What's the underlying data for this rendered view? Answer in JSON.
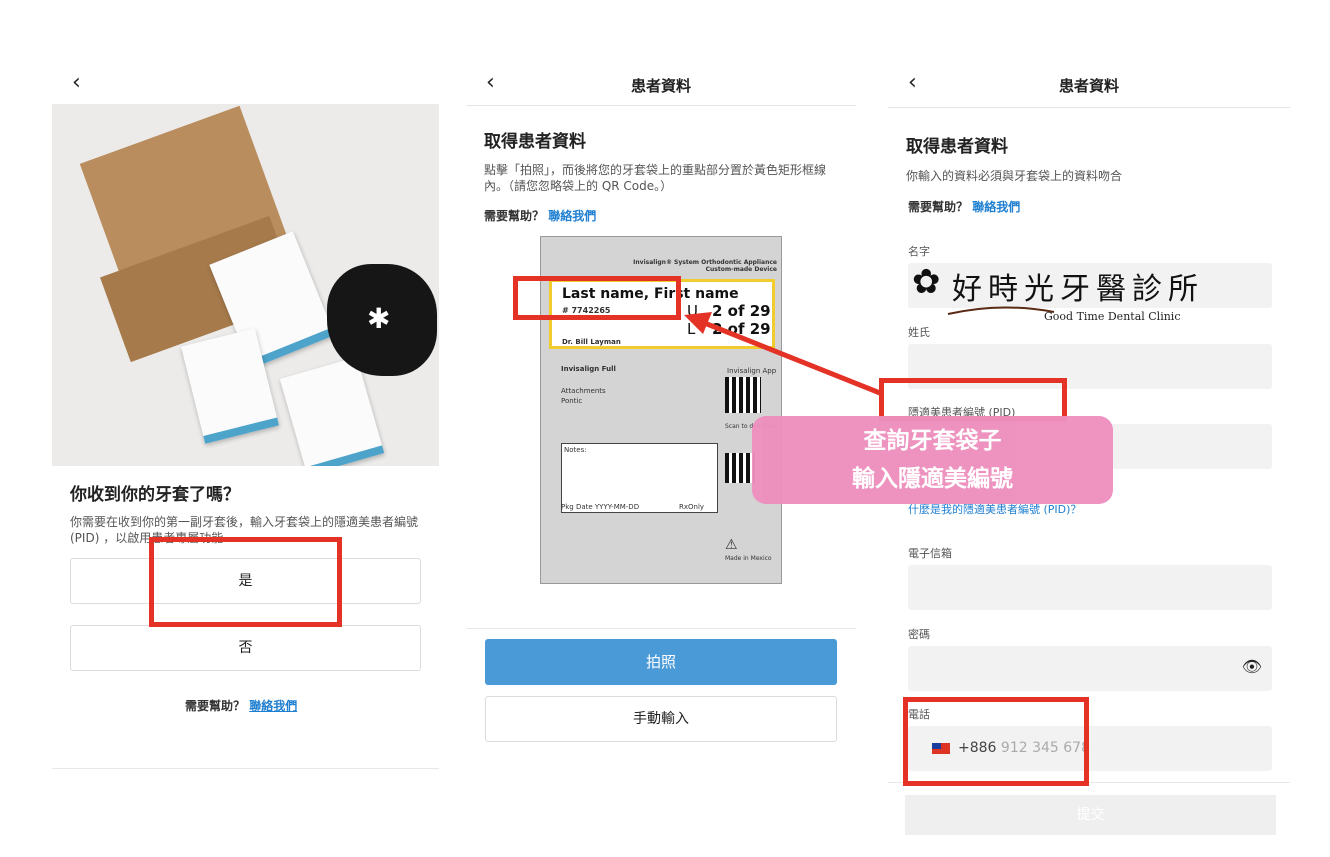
{
  "screen1": {
    "question": "你收到你的牙套了嗎？",
    "description": "你需要在收到你的第一副牙套後，輸入牙套袋上的隱適美患者編號 (PID) ，以啟用患者專屬功能",
    "yes_label": "是",
    "no_label": "否",
    "help_text": "需要幫助？",
    "help_link": "聯絡我們"
  },
  "screen2": {
    "header_title": "患者資料",
    "section_title": "取得患者資料",
    "description": "點擊「拍照」，而後將您的牙套袋上的重點部分置於黃色矩形框線內。（請您忽略袋上的 QR Code。）",
    "help_text": "需要幫助？",
    "help_link": "聯絡我們",
    "card": {
      "brand": "Invisalign® System Orthodontic Appliance",
      "brand_sub": "Custom-made Device",
      "name": "Last name, First name",
      "patient_id": "# 7742265",
      "upper": "U",
      "lower": "L",
      "count1": "2 of 29",
      "count2": "2 of 29",
      "doctor": "Dr. Bill Layman",
      "product": "Invisalign Full",
      "attachments": "Attachments",
      "pontic": "Pontic",
      "app": "Invisalign App",
      "scan": "Scan to download",
      "notes": "Notes:",
      "pkg_date": "Pkg Date YYYY-MM-DD",
      "rx": "RxOnly",
      "made_in": "Made in Mexico"
    },
    "photo_button": "拍照",
    "manual_button": "手動輸入"
  },
  "screen3": {
    "header_title": "患者資料",
    "section_title": "取得患者資料",
    "description": "你輸入的資料必須與牙套袋上的資料吻合",
    "help_text": "需要幫助？",
    "help_link": "聯絡我們",
    "first_name_label": "名字",
    "last_name_label": "姓氏",
    "pid_label": "隱適美患者編號 (PID)",
    "pid_help_link": "什麼是我的隱適美患者編號 (PID)？",
    "email_label": "電子信箱",
    "password_label": "密碼",
    "phone_label": "電話",
    "phone_code": "+886",
    "phone_placeholder": "912 345 678",
    "submit_label": "提交"
  },
  "logo": {
    "name": "好時光牙醫診所",
    "english": "Good Time Dental Clinic"
  },
  "callout": {
    "line1": "查詢牙套袋子",
    "line2": "輸入隱適美編號"
  },
  "colors": {
    "highlight_red": "#e53227",
    "callout_pink": "#ee8fbd",
    "primary_blue": "#4a9ad8",
    "link_blue": "#1f7fd0"
  }
}
